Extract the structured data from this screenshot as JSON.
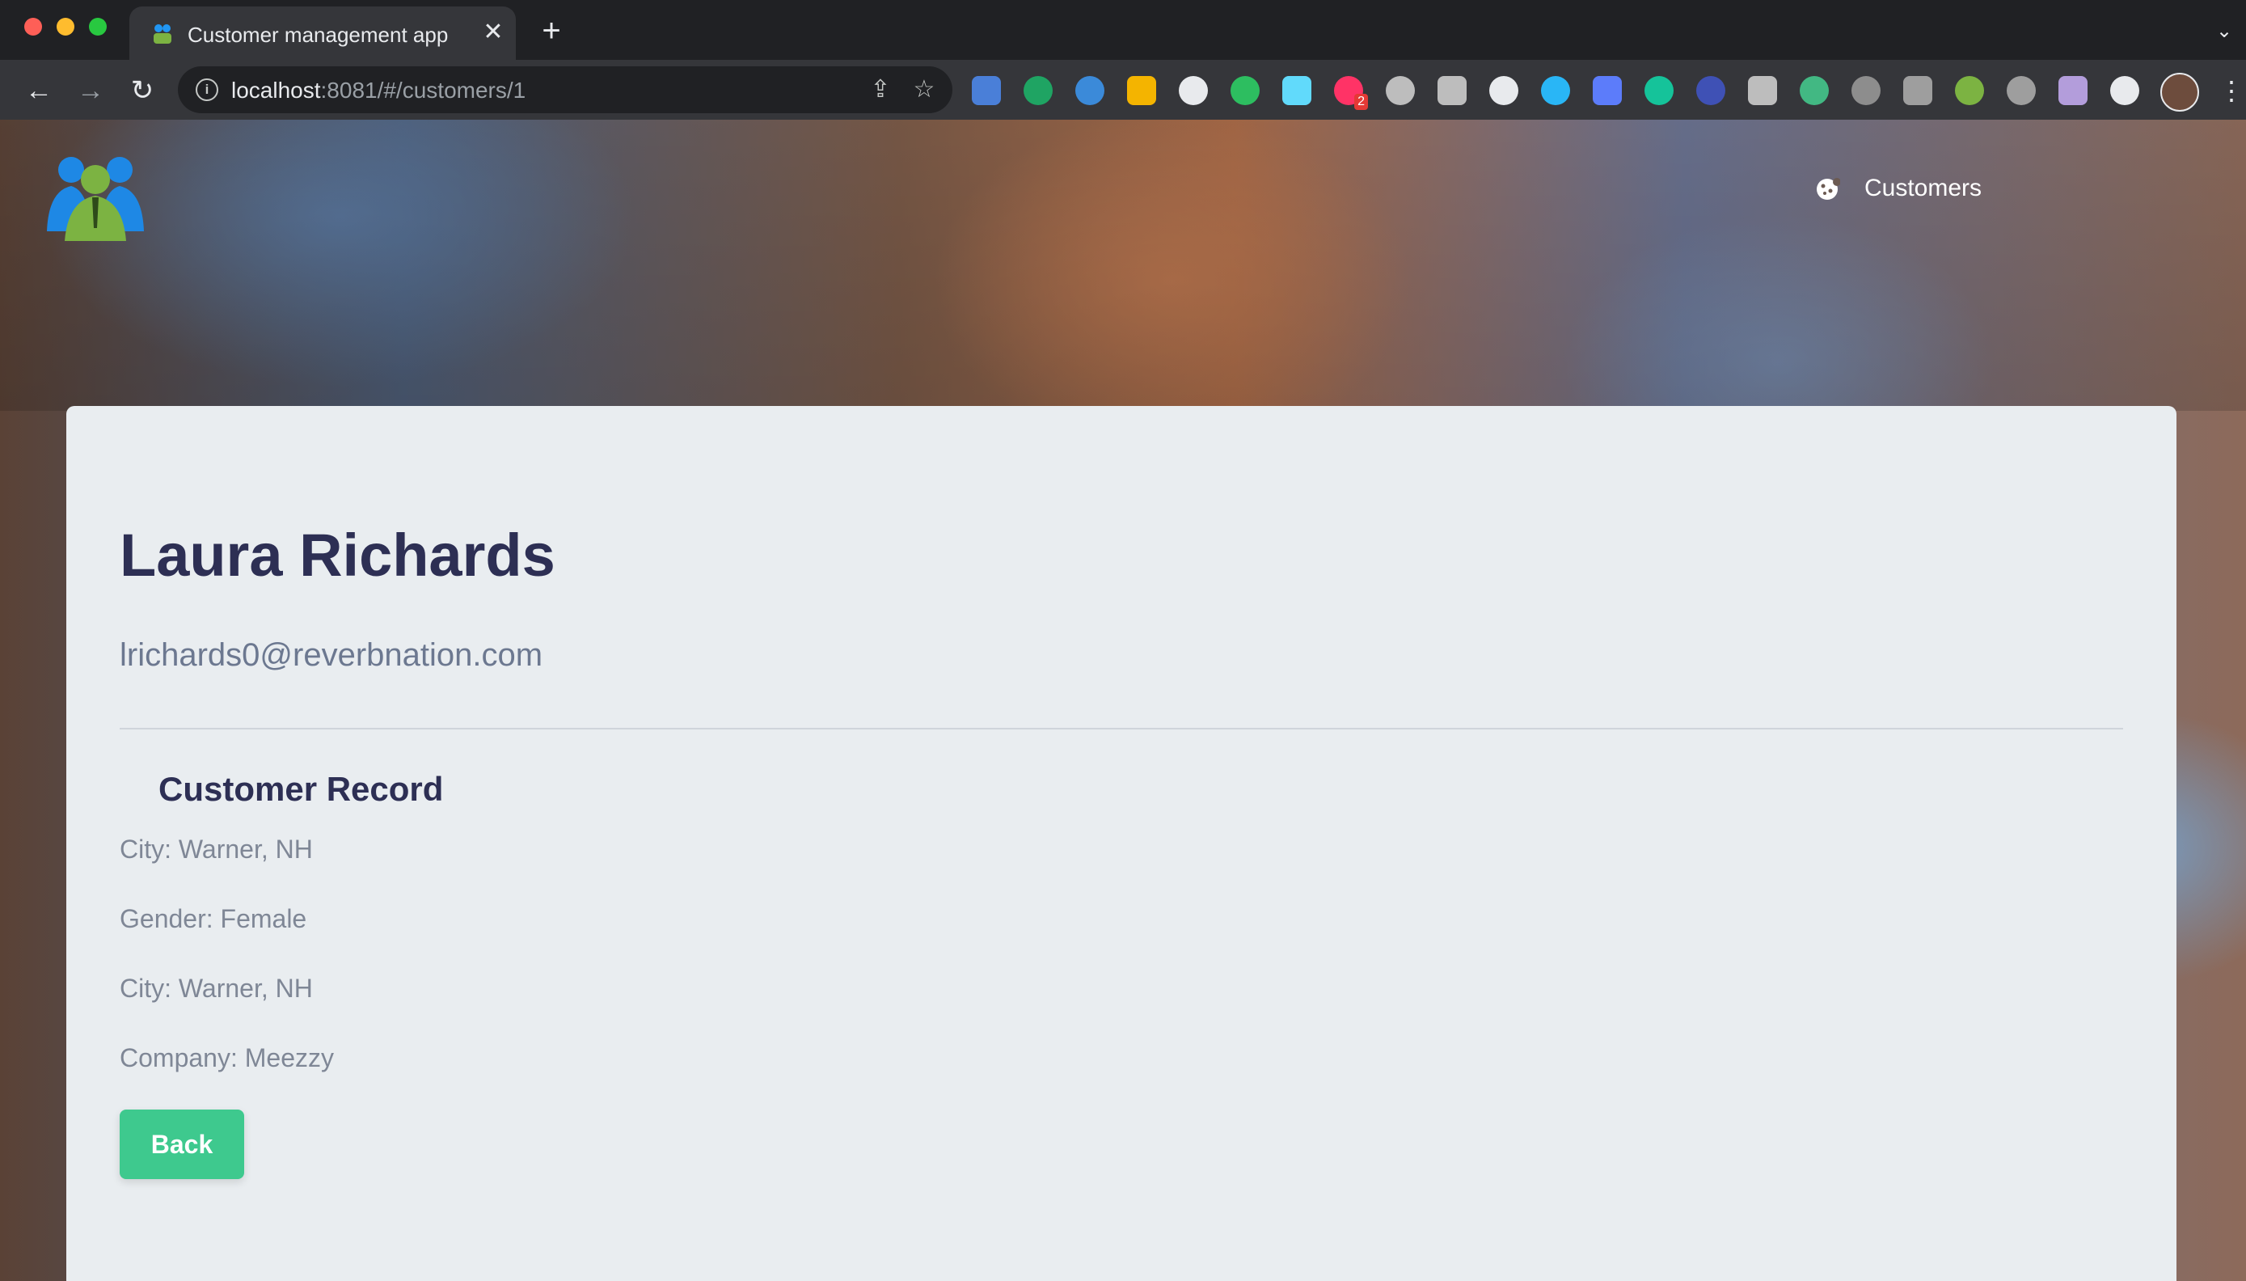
{
  "browser": {
    "tab_title": "Customer management app",
    "tab_close": "✕",
    "new_tab": "+",
    "url_host": "localhost",
    "url_path": ":8081/#/customers/1",
    "extensions": [
      {
        "name": "translate-ext-icon",
        "color": "#4a7fd8"
      },
      {
        "name": "drive-ext-icon",
        "color": "#1fa463"
      },
      {
        "name": "globe-ext-icon",
        "color": "#3b8ad9"
      },
      {
        "name": "compass-ext-icon",
        "color": "#f4b400"
      },
      {
        "name": "react-ext-icon",
        "color": "#e8eaed"
      },
      {
        "name": "evernote-ext-icon",
        "color": "#2dbe60"
      },
      {
        "name": "react-devtools-ext-icon",
        "color": "#61dafb"
      },
      {
        "name": "invision-ext-icon",
        "color": "#ff3366",
        "badge": "2"
      },
      {
        "name": "target-ext-icon",
        "color": "#bdbdbd"
      },
      {
        "name": "pocket-ext-icon",
        "color": "#bdbdbd"
      },
      {
        "name": "json-ext-icon",
        "color": "#e8eaed"
      },
      {
        "name": "share-ext-icon",
        "color": "#29b6f6"
      },
      {
        "name": "screen-ext-icon",
        "color": "#5c7cfa"
      },
      {
        "name": "grammarly-ext-icon",
        "color": "#15c39a"
      },
      {
        "name": "layers-ext-icon",
        "color": "#3f51b5"
      },
      {
        "name": "buffer-ext-icon",
        "color": "#bdbdbd"
      },
      {
        "name": "vue-ext-icon",
        "color": "#42b883"
      },
      {
        "name": "pen-ext-icon",
        "color": "#8d8d8d"
      },
      {
        "name": "check-ext-icon",
        "color": "#9e9e9e"
      },
      {
        "name": "tag-ext-icon",
        "color": "#7cb342"
      },
      {
        "name": "rainbow-ext-icon",
        "color": "#9e9e9e"
      },
      {
        "name": "feather-ext-icon",
        "color": "#b39ddb"
      },
      {
        "name": "puzzle-ext-icon",
        "color": "#e8eaed"
      }
    ]
  },
  "nav": {
    "customers_label": "Customers"
  },
  "customer": {
    "name": "Laura Richards",
    "email": "lrichards0@reverbnation.com",
    "record_title": "Customer Record",
    "fields": [
      "City: Warner, NH",
      "Gender: Female",
      "City: Warner, NH",
      "Company: Meezzy"
    ],
    "back_label": "Back"
  },
  "colors": {
    "accent": "#3ec98e",
    "heading": "#2d2f54",
    "card_bg": "#e9edf0"
  }
}
